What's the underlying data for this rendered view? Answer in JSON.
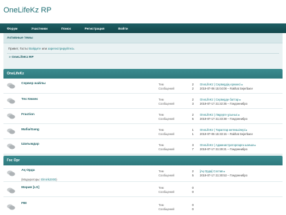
{
  "site": {
    "title": "OneLifeKz RP"
  },
  "nav": [
    "Форум",
    "Участники",
    "Поиск",
    "Регистрация",
    "Войти"
  ],
  "active_topics": "Активные темы",
  "welcome": {
    "prefix": "Привет, Гость!",
    "login": "Войдите",
    "or": "или",
    "register": "зарегистрируйтесь"
  },
  "crumb": "» OneLifeKz RP",
  "categories": [
    {
      "name": "OneLifeKz",
      "forums": [
        {
          "title": "Сервер жайлы",
          "sub": "",
          "topics_label": "Тем",
          "topics": "2",
          "posts_label": "Сообщений",
          "posts": "2",
          "last_title": "OneLifeKz | Сервердің ережесі ▸",
          "last_meta": "2019-07-06 15:04:08 – Rakhat Sejerbaev"
        },
        {
          "title": "Тех Көмек",
          "sub": "",
          "topics_label": "Тем",
          "topics": "2",
          "posts_label": "Сообщений",
          "posts": "3",
          "last_title": "OneLifeKz | Серверде баттар ▸",
          "last_meta": "2019-07-17 21:22:35 – Гондоннибро"
        },
        {
          "title": "Fraction",
          "sub": "",
          "topics_label": "Тем",
          "topics": "2",
          "posts_label": "Сообщений",
          "posts": "5",
          "last_title": "OneLifeKz | Лидерге ұсыныс ▸",
          "last_meta": "2019-07-17 21:23:38 – Гондоннибро"
        },
        {
          "title": "Mafia/Gang",
          "sub": "",
          "topics_label": "Тем",
          "topics": "1",
          "posts_label": "Сообщений",
          "posts": "1",
          "last_title": "OneLifeKz | Тараптар жетекшілері ▸",
          "last_meta": "2019-07-06 15:33:15 – Rakhat Sejerbaev"
        },
        {
          "title": "Шағымдар",
          "sub": "",
          "topics_label": "Тем",
          "topics": "3",
          "posts_label": "Сообщений",
          "posts": "7",
          "last_title": "OneLifeKz | Администраторларға шағым ▸",
          "last_meta": "2019-07-17 21:29:21 – Гондоннибро"
        }
      ]
    },
    {
      "name": "Гос Орг",
      "forums": [
        {
          "title": "Ақ Орда",
          "sub_prefix": "(Модераторы:",
          "sub_link": "Elmirik2000",
          "sub_suffix": ")",
          "topics_label": "Тем",
          "topics": "2",
          "posts_label": "Сообщений",
          "posts": "5",
          "last_title": "[Ақ Орда] Состав ▸",
          "last_meta": "2019-07-17 21:30:53 – Гондоннибро"
        },
        {
          "title": "Мэрия [LS]",
          "sub": "",
          "topics_label": "Тем",
          "topics": "0",
          "posts_label": "Сообщений",
          "posts": "0",
          "last_title": "",
          "last_meta": ""
        },
        {
          "title": "FBI",
          "sub": "",
          "topics_label": "Тем",
          "topics": "0",
          "posts_label": "Сообщений",
          "posts": "0",
          "last_title": "",
          "last_meta": ""
        }
      ]
    }
  ],
  "colors": {
    "accent": "#1e5f64",
    "category_bar": "#3a8b8f",
    "link": "#1e7f86"
  },
  "icons": {
    "forum": "speech-bubbles-icon"
  }
}
